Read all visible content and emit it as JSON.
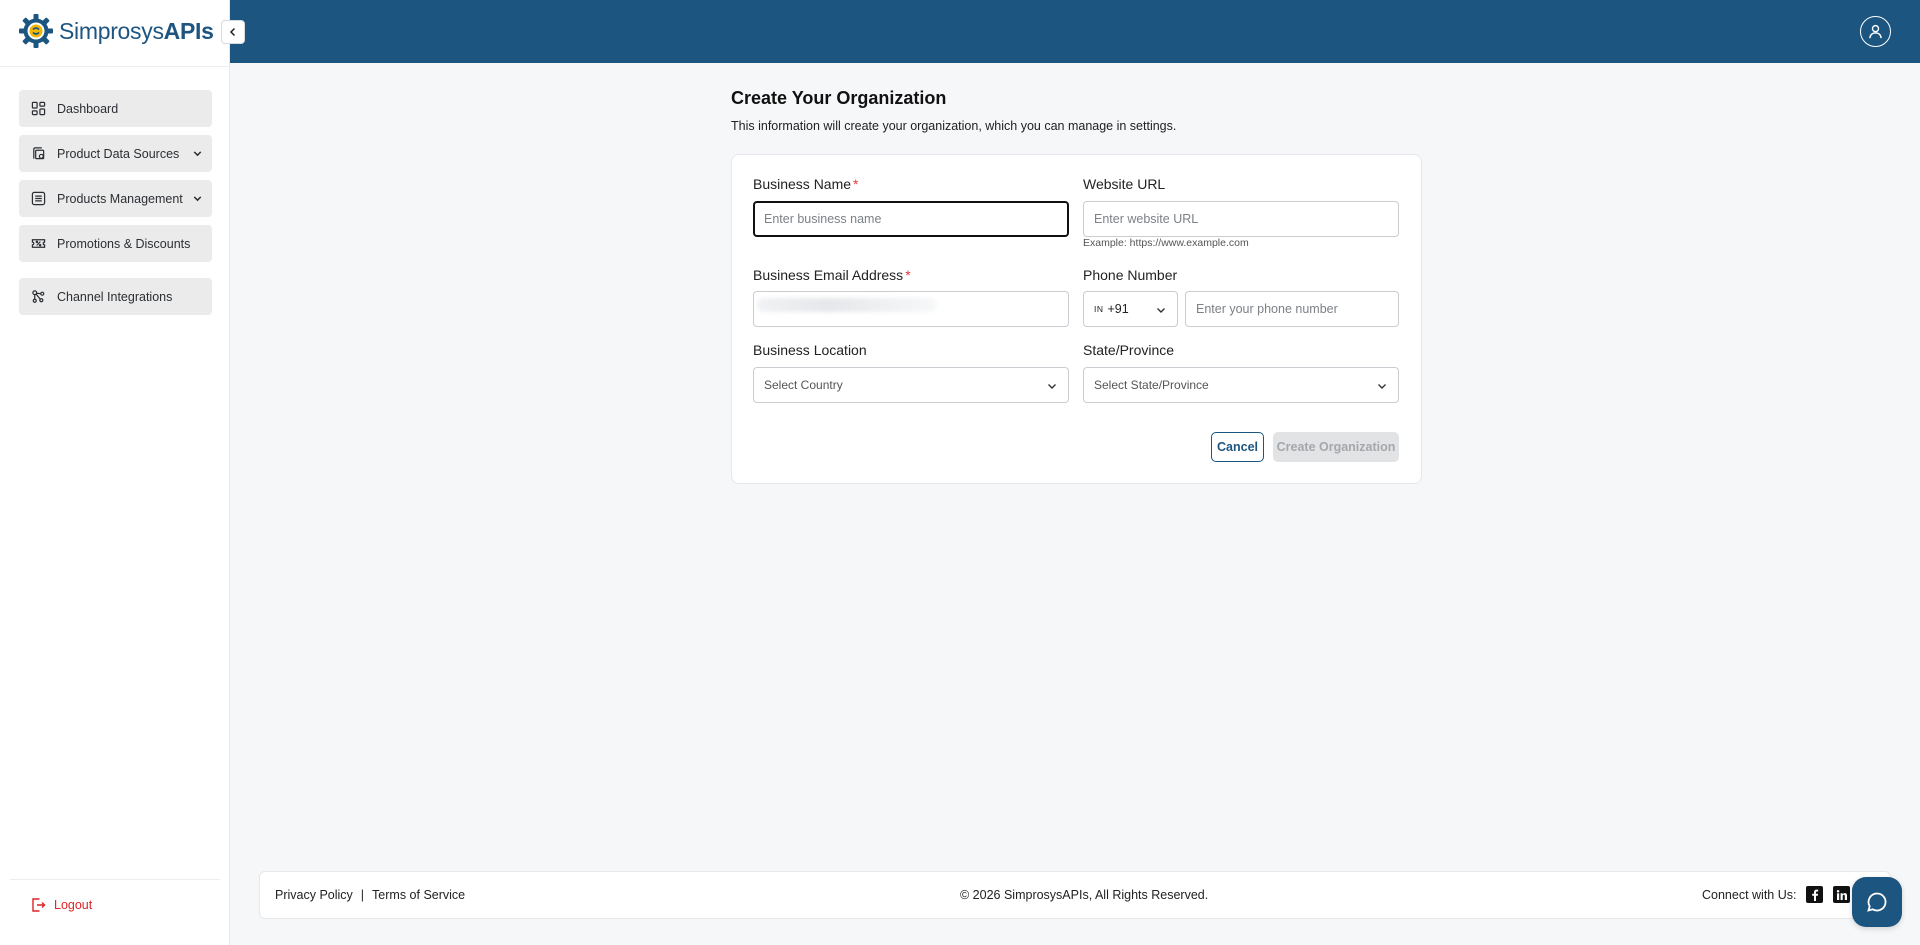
{
  "brand": {
    "name_prefix": "Simprosys",
    "name_suffix": "APIs"
  },
  "sidebar": {
    "items": [
      {
        "label": "Dashboard",
        "icon": "dashboard-icon",
        "expandable": false
      },
      {
        "label": "Product Data Sources",
        "icon": "data-sources-icon",
        "expandable": true
      },
      {
        "label": "Products Management",
        "icon": "products-list-icon",
        "expandable": true
      },
      {
        "label": "Promotions & Discounts",
        "icon": "ticket-icon",
        "expandable": false
      },
      {
        "label": "Channel Integrations",
        "icon": "integrations-icon",
        "expandable": false
      }
    ],
    "logout_label": "Logout"
  },
  "page": {
    "title": "Create Your Organization",
    "subtitle": "This information will create your organization, which you can manage in settings."
  },
  "form": {
    "business_name": {
      "label": "Business Name",
      "required_mark": "*",
      "placeholder": "Enter business name",
      "value": ""
    },
    "website_url": {
      "label": "Website URL",
      "placeholder": "Enter website URL",
      "hint": "Example: https://www.example.com",
      "value": ""
    },
    "business_email": {
      "label": "Business Email Address",
      "required_mark": "*"
    },
    "phone": {
      "label": "Phone Number",
      "country_flag": "IN",
      "country_code": "+91",
      "placeholder": "Enter your phone number",
      "value": ""
    },
    "business_location": {
      "label": "Business Location",
      "selected": "Select Country"
    },
    "state": {
      "label": "State/Province",
      "selected": "Select State/Province"
    },
    "cancel_label": "Cancel",
    "create_label": "Create Organization"
  },
  "footer": {
    "privacy": "Privacy Policy",
    "separator": "|",
    "terms": "Terms of Service",
    "copyright": "© 2026 SimprosysAPIs, All Rights Reserved.",
    "connect": "Connect with Us:",
    "social": [
      "facebook-icon",
      "linkedin-icon"
    ]
  },
  "colors": {
    "primary": "#1c5580",
    "danger": "#e12424",
    "required": "#e53935",
    "disabled_bg": "#e2e3e5",
    "disabled_text": "#a4a7ab",
    "page_bg": "#f6f7f9"
  }
}
